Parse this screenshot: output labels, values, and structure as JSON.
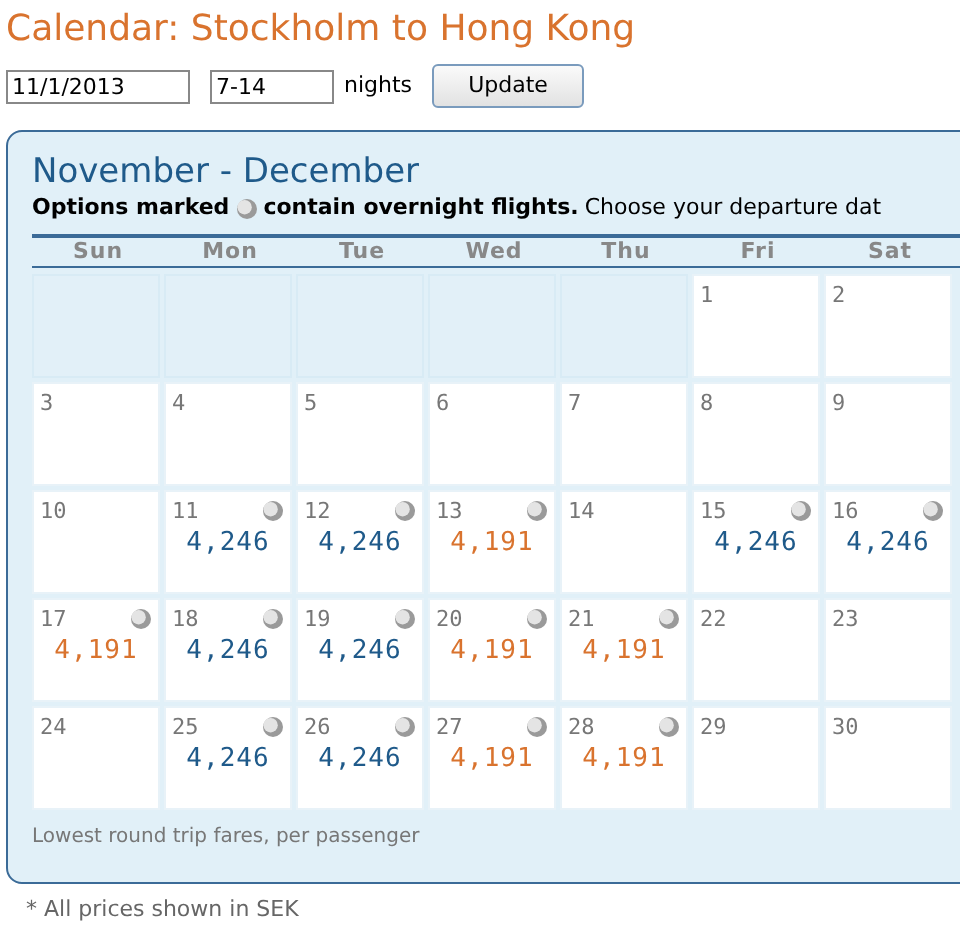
{
  "title": "Calendar: Stockholm to Hong Kong",
  "search": {
    "date": "11/1/2013",
    "nights": "7-14",
    "nights_label": "nights",
    "button": "Update"
  },
  "calendar": {
    "heading": "November - December",
    "note_bold_start": "Options marked",
    "note_bold_end": "contain overnight flights.",
    "note_rest": "Choose your departure dat",
    "weekdays": [
      "Sun",
      "Mon",
      "Tue",
      "Wed",
      "Thu",
      "Fri",
      "Sat"
    ],
    "weeks": [
      [
        {
          "kind": "blank"
        },
        {
          "kind": "blank"
        },
        {
          "kind": "blank"
        },
        {
          "kind": "blank"
        },
        {
          "kind": "blank"
        },
        {
          "kind": "day",
          "day": "1",
          "overnight": false
        },
        {
          "kind": "day",
          "day": "2",
          "overnight": false
        }
      ],
      [
        {
          "kind": "day",
          "day": "3",
          "overnight": false
        },
        {
          "kind": "day",
          "day": "4",
          "overnight": false
        },
        {
          "kind": "day",
          "day": "5",
          "overnight": false
        },
        {
          "kind": "day",
          "day": "6",
          "overnight": false
        },
        {
          "kind": "day",
          "day": "7",
          "overnight": false
        },
        {
          "kind": "day",
          "day": "8",
          "overnight": false
        },
        {
          "kind": "day",
          "day": "9",
          "overnight": false
        }
      ],
      [
        {
          "kind": "day",
          "day": "10",
          "overnight": false
        },
        {
          "kind": "day",
          "day": "11",
          "overnight": true,
          "price": "4,246",
          "color": "#1f5a8a"
        },
        {
          "kind": "day",
          "day": "12",
          "overnight": true,
          "price": "4,246",
          "color": "#1f5a8a"
        },
        {
          "kind": "day",
          "day": "13",
          "overnight": true,
          "price": "4,191",
          "color": "#d9732e"
        },
        {
          "kind": "day",
          "day": "14",
          "overnight": false
        },
        {
          "kind": "day",
          "day": "15",
          "overnight": true,
          "price": "4,246",
          "color": "#1f5a8a"
        },
        {
          "kind": "day",
          "day": "16",
          "overnight": true,
          "price": "4,246",
          "color": "#1f5a8a"
        }
      ],
      [
        {
          "kind": "day",
          "day": "17",
          "overnight": true,
          "price": "4,191",
          "color": "#d9732e"
        },
        {
          "kind": "day",
          "day": "18",
          "overnight": true,
          "price": "4,246",
          "color": "#1f5a8a"
        },
        {
          "kind": "day",
          "day": "19",
          "overnight": true,
          "price": "4,246",
          "color": "#1f5a8a"
        },
        {
          "kind": "day",
          "day": "20",
          "overnight": true,
          "price": "4,191",
          "color": "#d9732e"
        },
        {
          "kind": "day",
          "day": "21",
          "overnight": true,
          "price": "4,191",
          "color": "#d9732e"
        },
        {
          "kind": "day",
          "day": "22",
          "overnight": false
        },
        {
          "kind": "day",
          "day": "23",
          "overnight": false
        }
      ],
      [
        {
          "kind": "day",
          "day": "24",
          "overnight": false
        },
        {
          "kind": "day",
          "day": "25",
          "overnight": true,
          "price": "4,246",
          "color": "#1f5a8a"
        },
        {
          "kind": "day",
          "day": "26",
          "overnight": true,
          "price": "4,246",
          "color": "#1f5a8a"
        },
        {
          "kind": "day",
          "day": "27",
          "overnight": true,
          "price": "4,191",
          "color": "#d9732e"
        },
        {
          "kind": "day",
          "day": "28",
          "overnight": true,
          "price": "4,191",
          "color": "#d9732e"
        },
        {
          "kind": "day",
          "day": "29",
          "overnight": false
        },
        {
          "kind": "day",
          "day": "30",
          "overnight": false
        }
      ]
    ],
    "footer": "Lowest round trip fares, per passenger"
  },
  "note": "* All prices shown in SEK"
}
